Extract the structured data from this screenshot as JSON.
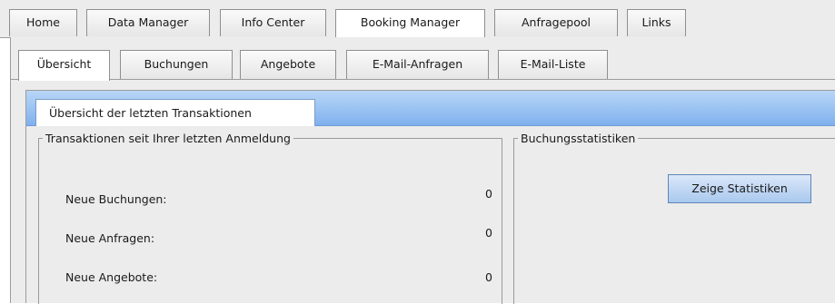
{
  "main_tabs": [
    {
      "label": "Home"
    },
    {
      "label": "Data Manager"
    },
    {
      "label": "Info Center"
    },
    {
      "label": "Booking Manager"
    },
    {
      "label": "Anfragepool"
    },
    {
      "label": "Links"
    }
  ],
  "sub_tabs": [
    {
      "label": "Übersicht"
    },
    {
      "label": "Buchungen"
    },
    {
      "label": "Angebote"
    },
    {
      "label": "E-Mail-Anfragen"
    },
    {
      "label": "E-Mail-Liste"
    }
  ],
  "panel": {
    "tab_label": "Übersicht der letzten Transaktionen"
  },
  "transactions": {
    "legend": "Transaktionen seit Ihrer letzten Anmeldung",
    "rows": [
      {
        "label": "Neue Buchungen:",
        "value": "0"
      },
      {
        "label": "Neue Anfragen:",
        "value": "0"
      },
      {
        "label": "Neue Angebote:",
        "value": "0"
      }
    ]
  },
  "stats": {
    "legend": "Buchungsstatistiken",
    "button_label": "Zeige Statistiken"
  },
  "colors": {
    "panel_header_blue": "#7fb1ee",
    "button_blue": "#a9c8ee",
    "background_gray": "#ececec"
  }
}
